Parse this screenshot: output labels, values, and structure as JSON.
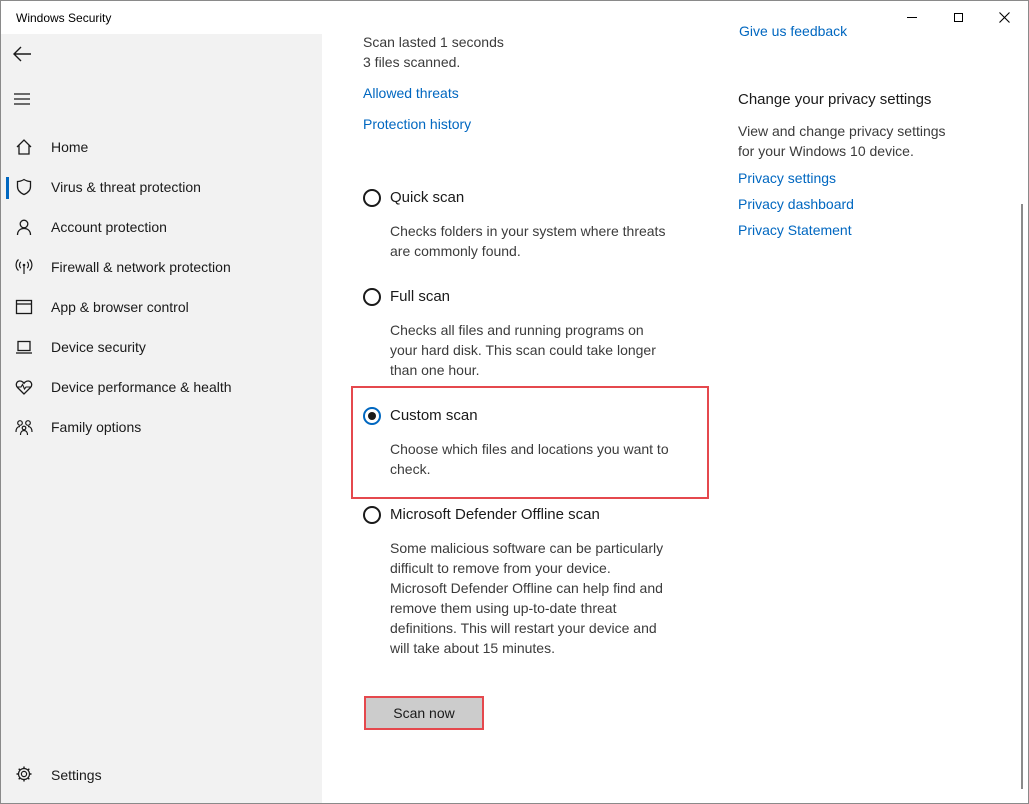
{
  "window": {
    "title": "Windows Security"
  },
  "sidebar": {
    "items": [
      {
        "label": "Home",
        "icon": "home-icon"
      },
      {
        "label": "Virus & threat protection",
        "icon": "shield-icon",
        "active": true
      },
      {
        "label": "Account protection",
        "icon": "person-icon"
      },
      {
        "label": "Firewall & network protection",
        "icon": "wifi-antenna-icon"
      },
      {
        "label": "App & browser control",
        "icon": "app-window-icon"
      },
      {
        "label": "Device security",
        "icon": "laptop-icon"
      },
      {
        "label": "Device performance & health",
        "icon": "heart-pulse-icon"
      },
      {
        "label": "Family options",
        "icon": "family-icon"
      }
    ],
    "settings_label": "Settings"
  },
  "main": {
    "scan_lasted": "Scan lasted 1 seconds",
    "files_scanned": "3 files scanned.",
    "allowed_threats_link": "Allowed threats",
    "protection_history_link": "Protection history",
    "options": [
      {
        "label": "Quick scan",
        "desc": [
          "Checks folders in your system where threats",
          "are commonly found."
        ],
        "checked": false
      },
      {
        "label": "Full scan",
        "desc": [
          "Checks all files and running programs on",
          "your hard disk. This scan could take longer",
          "than one hour."
        ],
        "checked": false
      },
      {
        "label": "Custom scan",
        "desc": [
          "Choose which files and locations you want to",
          "check."
        ],
        "checked": true
      },
      {
        "label": "Microsoft Defender Offline scan",
        "desc": [
          "Some malicious software can be particularly",
          "difficult to remove from your device.",
          "Microsoft Defender Offline can help find and",
          "remove them using up-to-date threat",
          "definitions. This will restart your device and",
          "will take about 15 minutes."
        ],
        "checked": false
      }
    ],
    "scan_button": "Scan now"
  },
  "right_panel": {
    "feedback_link": "Give us feedback",
    "heading": "Change your privacy settings",
    "description": [
      "View and change privacy settings",
      "for your Windows 10 device."
    ],
    "links": [
      "Privacy settings",
      "Privacy dashboard",
      "Privacy Statement"
    ]
  },
  "colors": {
    "accent": "#0067c0",
    "highlight": "#e5484d",
    "sidebar_bg": "#f2f2f2"
  }
}
